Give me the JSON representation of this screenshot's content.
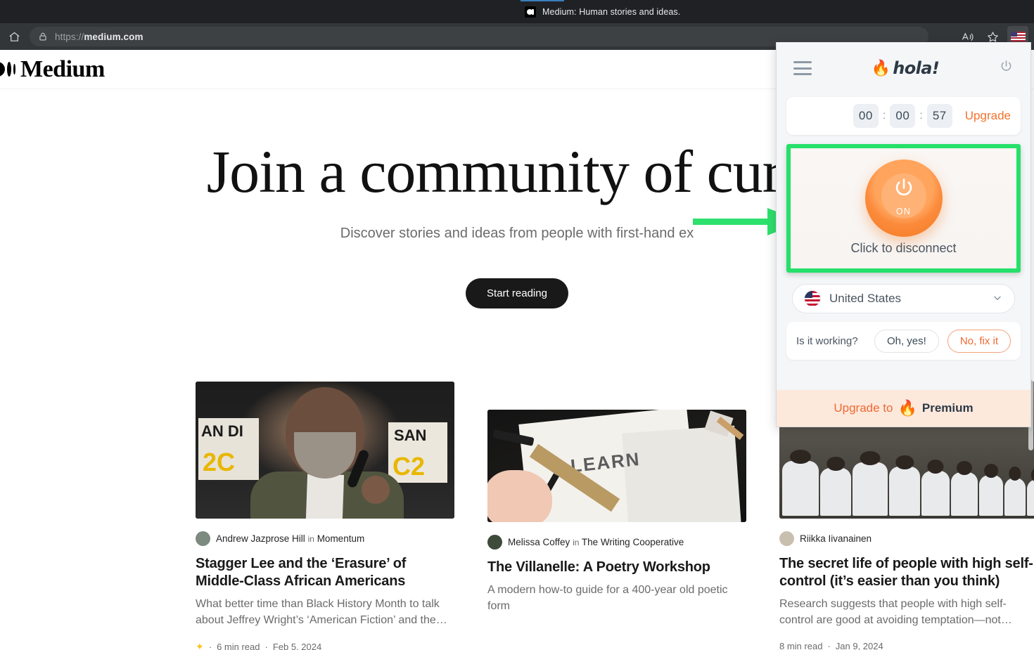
{
  "browser": {
    "tab": {
      "title": "Medium: Human stories and ideas.",
      "favicon": "medium-favicon"
    },
    "omnibox": {
      "scheme": "https://",
      "domain": "medium.com",
      "lock_icon": "lock-icon"
    },
    "toolbar_icons": {
      "home": "home-icon",
      "read_aloud": "read-aloud-icon",
      "favorites": "star-icon",
      "extension": "hola-vpn-extension-flag-icon"
    }
  },
  "site": {
    "logo_text": "Medium",
    "hero": {
      "headline": "Join a community of curio",
      "subhead": "Discover stories and ideas from people with first-hand ex",
      "cta": "Start reading"
    },
    "cards": [
      {
        "author": "Andrew Jazprose Hill",
        "in_word": "in",
        "publication": "Momentum",
        "title": "Stagger Lee and the ‘Erasure’ of Middle-Class African Americans",
        "excerpt": "What better time than Black History Month to talk about Jeffrey Wright’s ‘American Fiction’ and the…",
        "read_time": "6 min read",
        "date": "Feb 5, 2024",
        "member_star": true,
        "image_alt": "man-speaking-into-microphone-photo"
      },
      {
        "author": "Melissa Coffey",
        "in_word": "in",
        "publication": "The Writing Cooperative",
        "title": "The Villanelle: A Poetry Workshop",
        "excerpt": "A modern how-to guide for a 400-year old poetic form",
        "read_time": "",
        "date": "",
        "member_star": false,
        "image_alt": "hand-drawing-the-word-learn-in-notebook-photo"
      },
      {
        "author": "Riikka Iivanainen",
        "in_word": "",
        "publication": "",
        "title": "The secret life of people with high self-control (it’s easier than you think)",
        "excerpt": "Research suggests that people with high self-control are good at avoiding temptation—not…",
        "read_time": "8 min read",
        "date": "Jan 9, 2024",
        "member_star": false,
        "image_alt": "martial-arts-students-kneeling-in-a-row-photo"
      }
    ]
  },
  "vpn_panel": {
    "brand": "hola!",
    "brand_icon": "fire-emoji-icon",
    "menu_icon": "hamburger-menu-icon",
    "power_header_icon": "power-icon",
    "timer": {
      "hours": "00",
      "minutes": "00",
      "seconds": "57",
      "separator": ":"
    },
    "upgrade_label": "Upgrade",
    "connection": {
      "state_label": "ON",
      "hint": "Click to disconnect",
      "power_icon": "power-icon"
    },
    "country": {
      "name": "United States",
      "flag_icon": "us-flag-icon",
      "chevron_icon": "chevron-down-icon"
    },
    "feedback": {
      "question": "Is it working?",
      "yes_label": "Oh, yes!",
      "no_label": "No, fix it"
    },
    "premium": {
      "prefix": "Upgrade to",
      "icon": "fire-emoji-icon",
      "label": "Premium"
    }
  },
  "annotation": {
    "arrow": "green-arrow-pointing-right",
    "highlight": "green-rectangle-highlight",
    "colors": {
      "green": "#25e06a",
      "orange": "#f4781f",
      "premium_bg": "#fde8dc"
    }
  }
}
